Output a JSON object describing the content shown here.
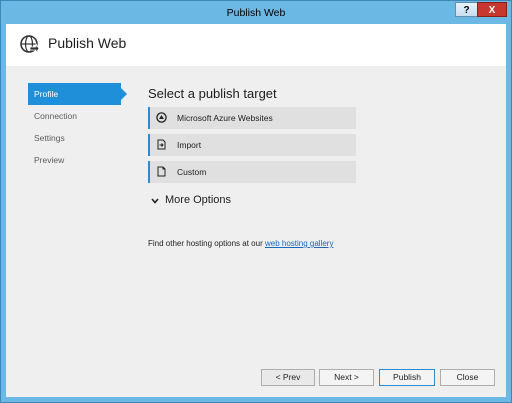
{
  "window": {
    "title": "Publish Web",
    "help_label": "?",
    "close_label": "X"
  },
  "header": {
    "title": "Publish Web",
    "icon": "globe-publish-icon"
  },
  "sidebar": {
    "items": [
      {
        "label": "Profile",
        "active": true
      },
      {
        "label": "Connection",
        "active": false
      },
      {
        "label": "Settings",
        "active": false
      },
      {
        "label": "Preview",
        "active": false
      }
    ]
  },
  "main": {
    "title": "Select a publish target",
    "targets": [
      {
        "label": "Microsoft Azure Websites",
        "icon": "azure-icon"
      },
      {
        "label": "Import",
        "icon": "import-icon"
      },
      {
        "label": "Custom",
        "icon": "document-icon"
      }
    ],
    "more_options": "More Options",
    "hosting_text": "Find other hosting options at our ",
    "hosting_link": "web hosting gallery"
  },
  "footer": {
    "prev": "< Prev",
    "next": "Next >",
    "publish": "Publish",
    "close": "Close"
  },
  "colors": {
    "accent": "#1f8fd9",
    "frame": "#6ab8e3",
    "close_button": "#c7372f",
    "link": "#1a66c0"
  }
}
